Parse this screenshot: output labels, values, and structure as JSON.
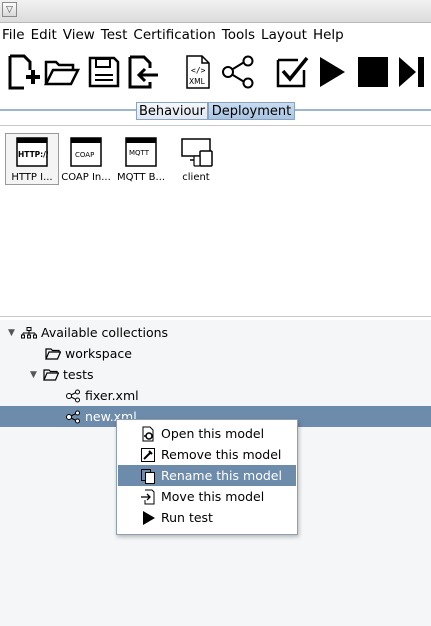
{
  "menu": [
    "File",
    "Edit",
    "View",
    "Test",
    "Certification",
    "Tools",
    "Layout",
    "Help"
  ],
  "toolbar": {
    "new": "new-model",
    "open": "open-model",
    "save": "save-model",
    "import": "import-model",
    "xml_label": "XML",
    "share": "graph",
    "validate": "check",
    "run": "run",
    "stop": "stop",
    "step": "step"
  },
  "tabs": {
    "behaviour": "Behaviour",
    "deployment": "Deployment"
  },
  "palette": [
    {
      "label": "HTTP I...",
      "icon_text": "HTTP://"
    },
    {
      "label": "COAP In...",
      "icon_text": "COAP"
    },
    {
      "label": "MQTT B...",
      "icon_text": "MQTT"
    },
    {
      "label": "client",
      "icon_text": ""
    }
  ],
  "tree": {
    "root": "Available collections",
    "workspace": "workspace",
    "tests": "tests",
    "fixer": "fixer.xml",
    "new": "new.xml"
  },
  "context_menu": [
    "Open this model",
    "Remove this model",
    "Rename this model",
    "Move this model",
    "Run test"
  ],
  "colors": {
    "selection": "#6d8bab",
    "tab_active": "#a9c5e4"
  }
}
